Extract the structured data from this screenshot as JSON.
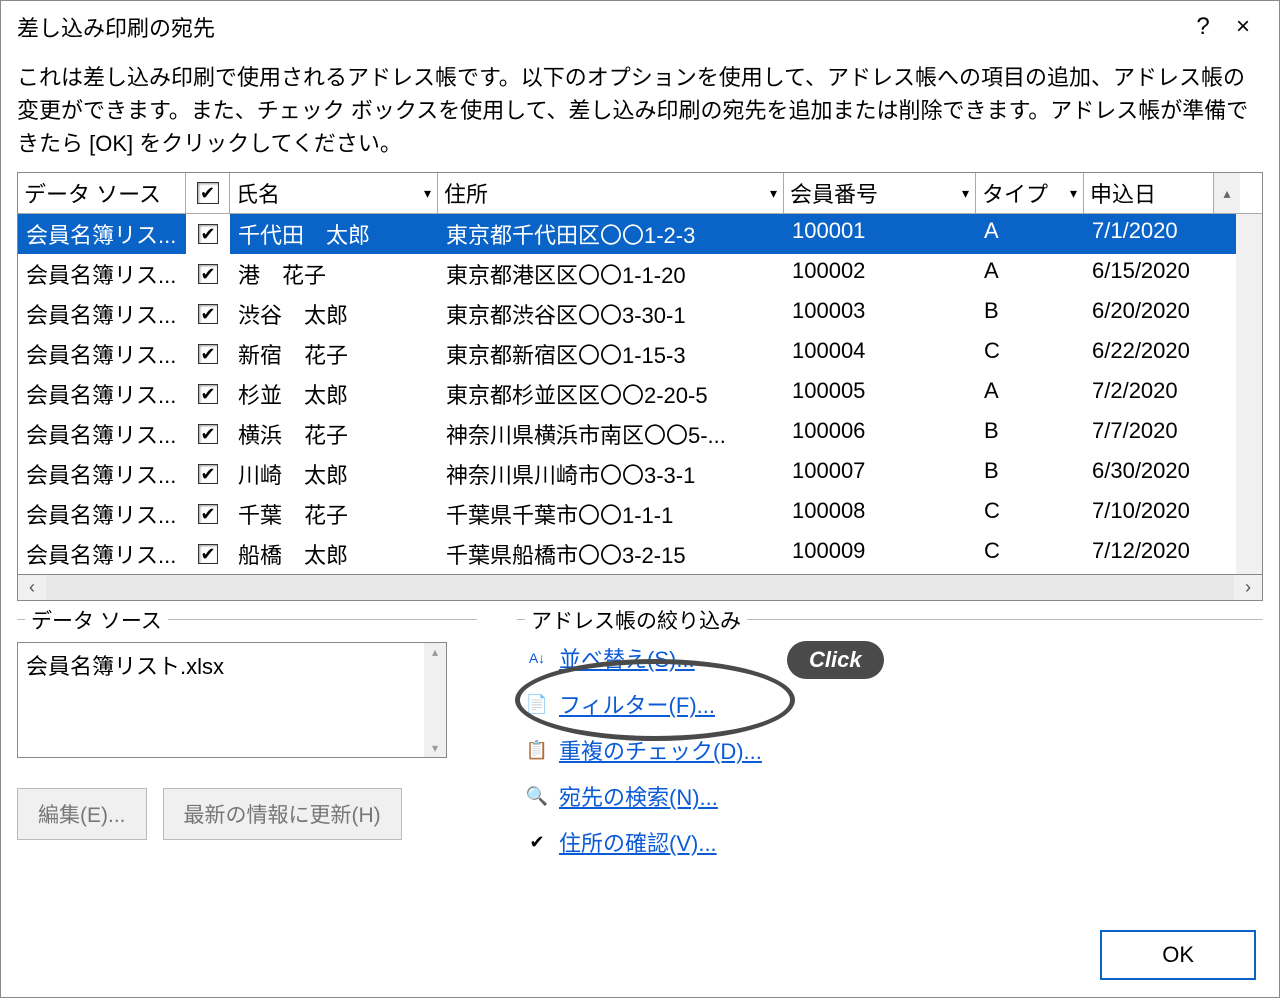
{
  "title": "差し込み印刷の宛先",
  "help_char": "?",
  "close_char": "×",
  "description": "これは差し込み印刷で使用されるアドレス帳です。以下のオプションを使用して、アドレス帳への項目の追加、アドレス帳の変更ができます。また、チェック ボックスを使用して、差し込み印刷の宛先を追加または削除できます。アドレス帳が準備できたら [OK] をクリックしてください。",
  "columns": {
    "data_source": "データ ソース",
    "name": "氏名",
    "address": "住所",
    "member_no": "会員番号",
    "type": "タイプ",
    "date": "申込日"
  },
  "rows": [
    {
      "ds": "会員名簿リス...",
      "name": "千代田　太郎",
      "addr": "東京都千代田区〇〇1-2-3",
      "num": "100001",
      "type": "A",
      "date": "7/1/2020"
    },
    {
      "ds": "会員名簿リス...",
      "name": "港　花子",
      "addr": "東京都港区区〇〇1-1-20",
      "num": "100002",
      "type": "A",
      "date": "6/15/2020"
    },
    {
      "ds": "会員名簿リス...",
      "name": "渋谷　太郎",
      "addr": "東京都渋谷区〇〇3-30-1",
      "num": "100003",
      "type": "B",
      "date": "6/20/2020"
    },
    {
      "ds": "会員名簿リス...",
      "name": "新宿　花子",
      "addr": "東京都新宿区〇〇1-15-3",
      "num": "100004",
      "type": "C",
      "date": "6/22/2020"
    },
    {
      "ds": "会員名簿リス...",
      "name": "杉並　太郎",
      "addr": "東京都杉並区区〇〇2-20-5",
      "num": "100005",
      "type": "A",
      "date": "7/2/2020"
    },
    {
      "ds": "会員名簿リス...",
      "name": "横浜　花子",
      "addr": "神奈川県横浜市南区〇〇5-...",
      "num": "100006",
      "type": "B",
      "date": "7/7/2020"
    },
    {
      "ds": "会員名簿リス...",
      "name": "川崎　太郎",
      "addr": "神奈川県川崎市〇〇3-3-1",
      "num": "100007",
      "type": "B",
      "date": "6/30/2020"
    },
    {
      "ds": "会員名簿リス...",
      "name": "千葉　花子",
      "addr": "千葉県千葉市〇〇1-1-1",
      "num": "100008",
      "type": "C",
      "date": "7/10/2020"
    },
    {
      "ds": "会員名簿リス...",
      "name": "船橋　太郎",
      "addr": "千葉県船橋市〇〇3-2-15",
      "num": "100009",
      "type": "C",
      "date": "7/12/2020"
    }
  ],
  "group_left_label": "データ ソース",
  "group_right_label": "アドレス帳の絞り込み",
  "listbox_file": "会員名簿リスト.xlsx",
  "buttons": {
    "edit": "編集(E)...",
    "refresh": "最新の情報に更新(H)"
  },
  "links": {
    "sort": "並べ替え(S)...",
    "filter": "フィルター(F)...",
    "dup": "重複のチェック(D)...",
    "find": "宛先の検索(N)...",
    "validate": "住所の確認(V)..."
  },
  "click_label": "Click",
  "ok": "OK",
  "drop_arrow": "▾",
  "up_arrow": "▴",
  "left_arrow": "‹",
  "right_arrow": "›"
}
